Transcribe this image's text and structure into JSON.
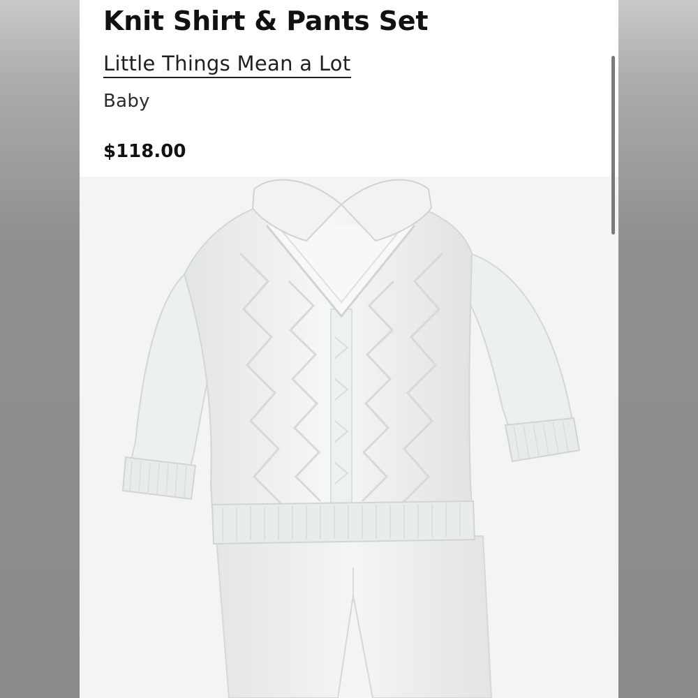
{
  "product": {
    "title": "Knit Shirt & Pants Set",
    "brand": "Little Things Mean a Lot",
    "category": "Baby",
    "price": "$118.00"
  },
  "image": {
    "subject": "knit-shirt-and-pants-set",
    "garment_color": "#f3f4f4",
    "background_color": "#f4f4f4"
  }
}
